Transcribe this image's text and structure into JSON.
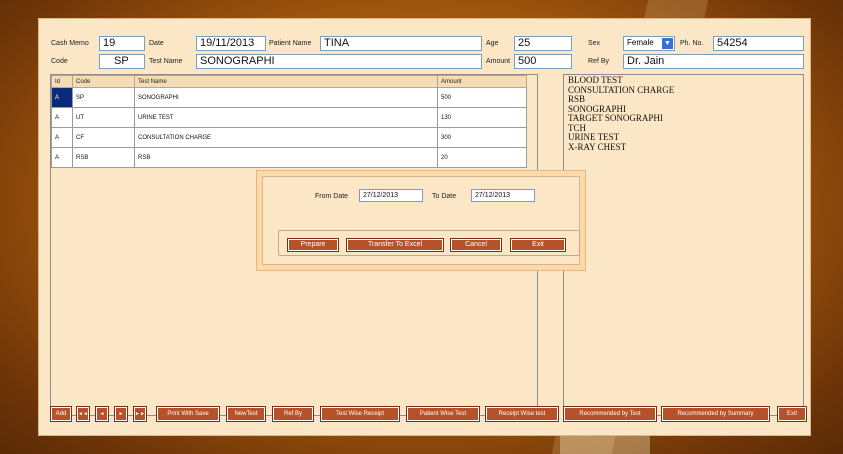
{
  "header": {
    "cash_memo_label": "Cash Memo",
    "cash_memo_value": "19",
    "date_label": "Date",
    "date_value": "19/11/2013",
    "patient_name_label": "Patient Name",
    "patient_name_value": "TINA",
    "age_label": "Age",
    "age_value": "25",
    "sex_label": "Sex",
    "sex_value": "Female",
    "phone_label": "Ph. No.",
    "phone_value": "54254",
    "code_label": "Code",
    "code_value": "SP",
    "test_name_label": "Test Name",
    "test_name_value": "SONOGRAPHI",
    "amount_label": "Amount",
    "amount_value": "500",
    "ref_by_label": "Ref By",
    "ref_by_value": "Dr. Jain"
  },
  "grid": {
    "columns": [
      "Id",
      "Code",
      "Test Name",
      "Amount"
    ],
    "rows": [
      [
        "A",
        "SP",
        "SONOGRAPHI",
        "500"
      ],
      [
        "A",
        "UT",
        "URINE TEST",
        "130"
      ],
      [
        "A",
        "CF",
        "CONSULTATION CHARGE",
        "300"
      ],
      [
        "A",
        "RSB",
        "RSB",
        "20"
      ]
    ]
  },
  "test_list": [
    "BLOOD TEST",
    "CONSULTATION CHARGE",
    "RSB",
    "SONOGRAPHI",
    "TARGET SONOGRAPHI",
    "TCH",
    "URINE TEST",
    "X-RAY CHEST"
  ],
  "dialog": {
    "from_date_label": "From Date",
    "from_date_value": "27/12/2013",
    "to_date_label": "To Date",
    "to_date_value": "27/12/2013",
    "prepare": "Prepare",
    "transfer": "Transfer To Excel",
    "cancel": "Cancel",
    "exit": "Exit"
  },
  "toolbar": {
    "add": "Add",
    "first": "◄◄",
    "prev": "◄",
    "next": "►",
    "last": "►►",
    "print_with_save": "Print With Save",
    "new_test": "NewTest",
    "ref_by": "Ref By",
    "test_wise_receipt": "Test Wise Receipt",
    "patient_wise_test": "Patient Wise Test",
    "receipt_wise_test": "Receipt Wise test",
    "recommended_by_test": "Recommended by Test",
    "recommended_by_summary": "Recommended by Summary",
    "exit": "Exit"
  },
  "colors": {
    "background": "#b8650f",
    "window": "#fbe6c6",
    "button": "#b5522a",
    "selection": "#0a2a7a"
  }
}
